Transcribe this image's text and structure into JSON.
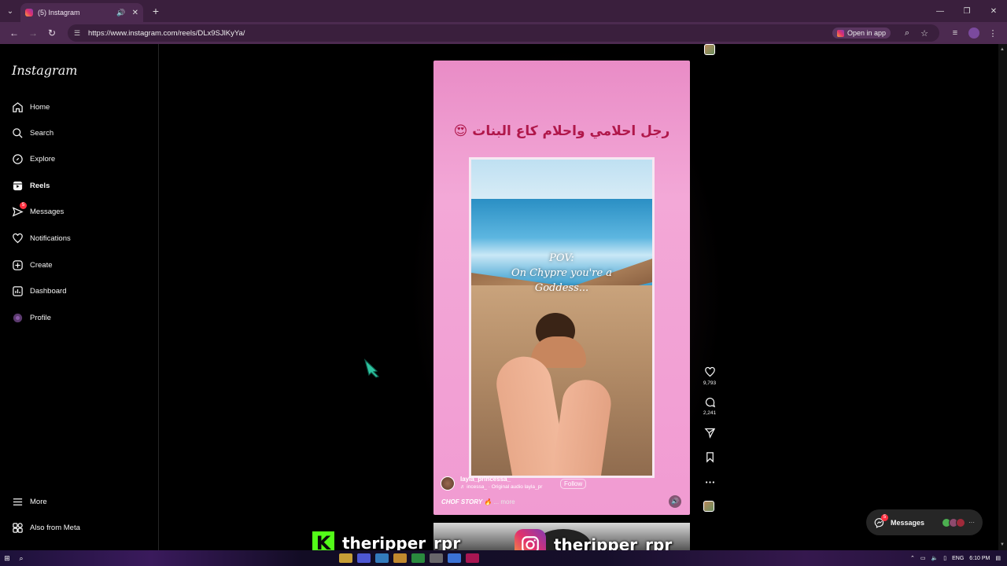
{
  "browser": {
    "tab_title": "(5) Instagram",
    "url": "https://www.instagram.com/reels/DLx9SJlKyYa/",
    "open_in_app": "Open in app"
  },
  "sidebar": {
    "logo": "Instagram",
    "items": [
      {
        "label": "Home",
        "icon": "home-icon"
      },
      {
        "label": "Search",
        "icon": "search-icon"
      },
      {
        "label": "Explore",
        "icon": "compass-icon"
      },
      {
        "label": "Reels",
        "icon": "reels-icon"
      },
      {
        "label": "Messages",
        "icon": "messenger-icon",
        "badge": "5"
      },
      {
        "label": "Notifications",
        "icon": "heart-icon"
      },
      {
        "label": "Create",
        "icon": "plus-square-icon"
      },
      {
        "label": "Dashboard",
        "icon": "chart-icon"
      },
      {
        "label": "Profile",
        "icon": "avatar-icon"
      }
    ],
    "more": "More",
    "also_from_meta": "Also from Meta"
  },
  "reel": {
    "title_arabic": "رجل احلامي واحلام كاع البنات 😍",
    "overlay_line1": "POV:",
    "overlay_line2": "On Chypre you're a",
    "overlay_line3": "Goddess...",
    "username": "layla_princessa_",
    "audio": "♬ incessa_ · Original audio      layla_pr",
    "follow": "Follow",
    "caption_title": "CHOF STORY 🔥",
    "caption_more": "... more"
  },
  "actions": {
    "likes": "9,793",
    "comments": "2,241"
  },
  "messages_pill": {
    "label": "Messages",
    "badge": "5"
  },
  "overlay": {
    "kick_handle": "theripper_rpr",
    "ig_handle": "theripper_rpr"
  },
  "taskbar": {
    "lang": "ENG",
    "time": "6:10 PM"
  },
  "colors": {
    "reel_bg": "#f19bd2",
    "title_text": "#b0174a",
    "kick_green": "#53fc18",
    "badge_red": "#ff3040"
  }
}
